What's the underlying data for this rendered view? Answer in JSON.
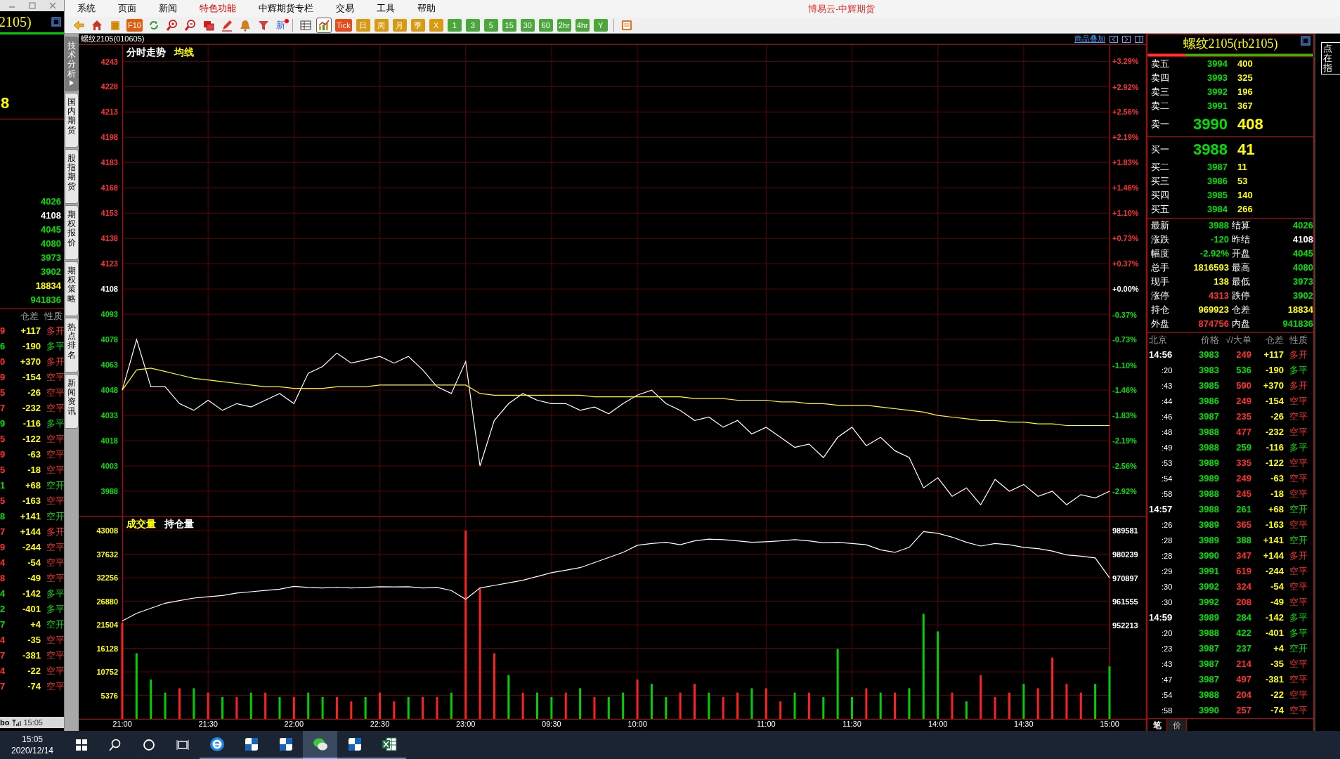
{
  "left_window": {
    "title": "2105)",
    "big_value": "8",
    "stats": [
      {
        "value": "4026",
        "color": "#00e000"
      },
      {
        "value": "4108",
        "color": "#ffffff"
      },
      {
        "value": "4045",
        "color": "#00e000"
      },
      {
        "value": "4080",
        "color": "#00e000"
      },
      {
        "value": "3973",
        "color": "#00e000"
      },
      {
        "value": "3902",
        "color": "#00e000"
      },
      {
        "value": "18834",
        "color": "#ffff00"
      },
      {
        "value": "941836",
        "color": "#00e000"
      }
    ],
    "tick_headers": [
      "仓差",
      "性质"
    ],
    "ticks": [
      {
        "column_1": "9",
        "oi_change": "+117",
        "nature": "多开",
        "color": "#ff3030"
      },
      {
        "column_1": "6",
        "oi_change": "-190",
        "nature": "多平",
        "color": "#00e000"
      },
      {
        "column_1": "0",
        "oi_change": "+370",
        "nature": "多开",
        "color": "#ff3030"
      },
      {
        "column_1": "9",
        "oi_change": "-154",
        "nature": "空平",
        "color": "#ff3030"
      },
      {
        "column_1": "5",
        "oi_change": "-26",
        "nature": "空平",
        "color": "#ff3030"
      },
      {
        "column_1": "7",
        "oi_change": "-232",
        "nature": "空平",
        "color": "#ff3030"
      },
      {
        "column_1": "9",
        "oi_change": "-116",
        "nature": "多平",
        "color": "#00e000"
      },
      {
        "column_1": "5",
        "oi_change": "-122",
        "nature": "空平",
        "color": "#ff3030"
      },
      {
        "column_1": "9",
        "oi_change": "-63",
        "nature": "空平",
        "color": "#ff3030"
      },
      {
        "column_1": "5",
        "oi_change": "-18",
        "nature": "空平",
        "color": "#ff3030"
      },
      {
        "column_1": "1",
        "oi_change": "+68",
        "nature": "空开",
        "color": "#00e000"
      },
      {
        "column_1": "5",
        "oi_change": "-163",
        "nature": "空平",
        "color": "#ff3030"
      },
      {
        "column_1": "8",
        "oi_change": "+141",
        "nature": "空开",
        "color": "#00e000"
      },
      {
        "column_1": "7",
        "oi_change": "+144",
        "nature": "多开",
        "color": "#ff3030"
      },
      {
        "column_1": "9",
        "oi_change": "-244",
        "nature": "空平",
        "color": "#ff3030"
      },
      {
        "column_1": "4",
        "oi_change": "-54",
        "nature": "空平",
        "color": "#ff3030"
      },
      {
        "column_1": "8",
        "oi_change": "-49",
        "nature": "空平",
        "color": "#ff3030"
      },
      {
        "column_1": "4",
        "oi_change": "-142",
        "nature": "多平",
        "color": "#00e000"
      },
      {
        "column_1": "2",
        "oi_change": "-401",
        "nature": "多平",
        "color": "#00e000"
      },
      {
        "column_1": "7",
        "oi_change": "+4",
        "nature": "空开",
        "color": "#00e000"
      },
      {
        "column_1": "4",
        "oi_change": "-35",
        "nature": "空平",
        "color": "#ff3030"
      },
      {
        "column_1": "7",
        "oi_change": "-381",
        "nature": "空平",
        "color": "#ff3030"
      },
      {
        "column_1": "4",
        "oi_change": "-22",
        "nature": "空平",
        "color": "#ff3030"
      },
      {
        "column_1": "7",
        "oi_change": "-74",
        "nature": "空平",
        "color": "#ff3030"
      }
    ],
    "status_bar": {
      "text": "bo",
      "time": "15:05"
    }
  },
  "menu": [
    {
      "label": "系统",
      "highlighted": false
    },
    {
      "label": "页面",
      "highlighted": false
    },
    {
      "label": "新闻",
      "highlighted": false
    },
    {
      "label": "特色功能",
      "highlighted": true
    },
    {
      "label": "中辉期货专栏",
      "highlighted": false
    },
    {
      "label": "交易",
      "highlighted": false
    },
    {
      "label": "工具",
      "highlighted": false
    },
    {
      "label": "帮助",
      "highlighted": false
    }
  ],
  "app_title": "博易云-中辉期货",
  "toolbar": [
    {
      "kind": "icon",
      "selected": false
    },
    {
      "kind": "icon",
      "selected": false
    },
    {
      "kind": "icon",
      "selected": false
    },
    {
      "kind": "text",
      "label": "F10",
      "color": "#e06010",
      "selected": false
    },
    {
      "kind": "icon",
      "selected": false
    },
    {
      "kind": "icon",
      "selected": false
    },
    {
      "kind": "icon",
      "selected": false
    },
    {
      "kind": "icon",
      "selected": false
    },
    {
      "kind": "icon",
      "selected": false
    },
    {
      "kind": "icon",
      "selected": false
    },
    {
      "kind": "icon",
      "selected": false
    },
    {
      "kind": "new",
      "label": "新",
      "selected": false
    },
    {
      "kind": "separator"
    },
    {
      "kind": "icon",
      "selected": false
    },
    {
      "kind": "icon",
      "selected": true
    },
    {
      "kind": "text",
      "label": "Tick",
      "color": "#e84a1a",
      "selected": false
    },
    {
      "kind": "text",
      "label": "日",
      "color": "#d89a10",
      "selected": false
    },
    {
      "kind": "text",
      "label": "周",
      "color": "#d89a10",
      "selected": false
    },
    {
      "kind": "text",
      "label": "月",
      "color": "#d89a10",
      "selected": false
    },
    {
      "kind": "text",
      "label": "季",
      "color": "#d89a10",
      "selected": false
    },
    {
      "kind": "text",
      "label": "X",
      "color": "#d89a10",
      "selected": false
    },
    {
      "kind": "text",
      "label": "1",
      "color": "#4aa83a",
      "selected": false
    },
    {
      "kind": "text",
      "label": "3",
      "color": "#4aa83a",
      "selected": false
    },
    {
      "kind": "text",
      "label": "5",
      "color": "#4aa83a",
      "selected": false
    },
    {
      "kind": "text",
      "label": "15",
      "color": "#4aa83a",
      "selected": false
    },
    {
      "kind": "text",
      "label": "30",
      "color": "#4aa83a",
      "selected": false
    },
    {
      "kind": "text",
      "label": "60",
      "color": "#4aa83a",
      "selected": false
    },
    {
      "kind": "text",
      "label": "2hr",
      "color": "#4aa83a",
      "selected": false
    },
    {
      "kind": "text",
      "label": "4hr",
      "color": "#4aa83a",
      "selected": false
    },
    {
      "kind": "text",
      "label": "Y",
      "color": "#4aa83a",
      "selected": false
    },
    {
      "kind": "separator"
    },
    {
      "kind": "icon",
      "selected": false
    }
  ],
  "side_tabs": [
    {
      "label": "技术分析",
      "selected": true
    },
    {
      "label": "国内期货",
      "selected": false
    },
    {
      "label": "股指期货",
      "selected": false
    },
    {
      "label": "期权报价",
      "selected": false
    },
    {
      "label": "期权策略",
      "selected": false
    },
    {
      "label": "热点排名",
      "selected": false
    },
    {
      "label": "新闻资讯",
      "selected": false
    }
  ],
  "chart_header": {
    "title": "螺纹2105(010605)",
    "overlay_link": "商品叠加"
  },
  "price_panel": {
    "legend": [
      {
        "label": "分时走势",
        "color": "#ffffff"
      },
      {
        "label": "均线",
        "color": "#ffff00"
      }
    ],
    "chart_data": {
      "type": "line",
      "grid": true,
      "ylim": [
        3973.4,
        4252.8
      ],
      "y2lim": [
        -3.277,
        3.525
      ],
      "yticks": [
        4243,
        4228,
        4213,
        4198,
        4183,
        4168,
        4153,
        4138,
        4123,
        4108,
        4093,
        4078,
        4063,
        4048,
        4033,
        4018,
        4003,
        3988
      ],
      "y2ticks": [
        {
          "value": 3.29,
          "label": "+3.29%"
        },
        {
          "value": 2.92,
          "label": "+2.92%"
        },
        {
          "value": 2.56,
          "label": "+2.56%"
        },
        {
          "value": 2.19,
          "label": "+2.19%"
        },
        {
          "value": 1.83,
          "label": "+1.83%"
        },
        {
          "value": 1.46,
          "label": "+1.46%"
        },
        {
          "value": 1.1,
          "label": "+1.10%"
        },
        {
          "value": 0.73,
          "label": "+0.73%"
        },
        {
          "value": 0.37,
          "label": "+0.37%"
        },
        {
          "value": 0,
          "label": "+0.00%"
        },
        {
          "value": -0.37,
          "label": "-0.37%"
        },
        {
          "value": -0.73,
          "label": "-0.73%"
        },
        {
          "value": -1.1,
          "label": "-1.10%"
        },
        {
          "value": -1.46,
          "label": "-1.46%"
        },
        {
          "value": -1.83,
          "label": "-1.83%"
        },
        {
          "value": -2.19,
          "label": "-2.19%"
        },
        {
          "value": -2.56,
          "label": "-2.56%"
        },
        {
          "value": -2.92,
          "label": "-2.92%"
        }
      ],
      "categories": [
        null,
        null,
        null,
        null,
        null,
        null,
        null,
        null,
        null,
        null,
        null,
        null,
        null,
        null,
        null,
        null,
        null,
        null,
        null,
        null,
        null,
        null,
        null,
        null,
        null,
        null,
        null,
        null,
        null,
        null,
        null,
        null,
        null,
        null,
        null,
        null,
        null,
        null,
        null,
        null,
        null,
        null,
        null,
        null,
        null,
        null,
        null,
        null,
        null,
        null,
        null,
        null,
        null,
        null,
        null,
        null,
        null,
        null,
        null,
        null,
        null,
        null,
        null,
        null,
        null,
        null,
        null,
        null,
        null,
        null
      ],
      "series": [
        {
          "color": "#ffffff",
          "values": [
            4048,
            4078,
            4050,
            4050,
            4040,
            4036,
            4042,
            4036,
            4040,
            4038,
            4042,
            4046,
            4040,
            4058,
            4062,
            4070,
            4064,
            4066,
            4068,
            4064,
            4068,
            4060,
            4050,
            4046,
            4065,
            4003,
            4030,
            4040,
            4046,
            4042,
            4040,
            4040,
            4036,
            4038,
            4034,
            4040,
            4045,
            4048,
            4040,
            4036,
            4030,
            4032,
            4026,
            4030,
            4022,
            4026,
            4020,
            4014,
            4016,
            4008,
            4020,
            4026,
            4015,
            4020,
            4012,
            4008,
            3990,
            3996,
            3985,
            3990,
            3980,
            3995,
            3988,
            3992,
            3985,
            3988,
            3980,
            3986,
            3984,
            3988
          ]
        },
        {
          "color": "#ffff00",
          "values": [
            4048,
            4060,
            4061,
            4059,
            4057,
            4055,
            4054,
            4053,
            4052,
            4051,
            4050,
            4050,
            4049,
            4049,
            4049,
            4050,
            4050,
            4050,
            4051,
            4051,
            4051,
            4051,
            4051,
            4051,
            4051,
            4046,
            4045,
            4045,
            4045,
            4045,
            4045,
            4045,
            4045,
            4044,
            4044,
            4044,
            4044,
            4044,
            4044,
            4044,
            4043,
            4043,
            4043,
            4042,
            4042,
            4042,
            4041,
            4041,
            4040,
            4040,
            4039,
            4039,
            4039,
            4038,
            4037,
            4036,
            4035,
            4033,
            4032,
            4031,
            4030,
            4030,
            4029,
            4029,
            4028,
            4028,
            4027,
            4027,
            4027,
            4027
          ]
        }
      ]
    }
  },
  "volume_panel": {
    "legend": [
      {
        "label": "成交量",
        "color": "#ffff00"
      },
      {
        "label": "持仓量",
        "color": "#ffffff"
      }
    ],
    "chart_data": {
      "type": "bar",
      "grid": true,
      "ylim": [
        0,
        46218
      ],
      "y2lim": [
        915400,
        995117
      ],
      "yticks": [
        43008,
        37632,
        32256,
        26880,
        21504,
        16128,
        10752,
        5376
      ],
      "y2ticks": [
        989581,
        980239,
        970897,
        961555,
        952213
      ],
      "categories": [
        "21:00",
        null,
        null,
        null,
        null,
        null,
        "21:30",
        null,
        null,
        null,
        null,
        null,
        "22:00",
        null,
        null,
        null,
        null,
        null,
        "22:30",
        null,
        null,
        null,
        null,
        null,
        "23:00",
        null,
        null,
        null,
        null,
        null,
        "09:30",
        null,
        null,
        null,
        null,
        null,
        "10:00",
        null,
        null,
        null,
        null,
        null,
        null,
        null,
        null,
        "11:00",
        null,
        null,
        null,
        null,
        null,
        "11:30",
        null,
        null,
        null,
        null,
        null,
        "14:00",
        null,
        null,
        null,
        null,
        null,
        "14:30",
        null,
        null,
        null,
        null,
        null,
        "15:00"
      ],
      "series": [
        {
          "type": "bar",
          "color": "#ff2020",
          "values": [
            22000,
            null,
            null,
            null,
            7000,
            null,
            6000,
            null,
            5000,
            null,
            6000,
            null,
            5000,
            null,
            null,
            5000,
            4000,
            null,
            6000,
            4000,
            null,
            5000,
            5000,
            null,
            43000,
            30000,
            15000,
            null,
            6000,
            null,
            null,
            6000,
            null,
            5000,
            null,
            null,
            9000,
            null,
            null,
            6000,
            8000,
            null,
            5000,
            6000,
            null,
            7000,
            4000,
            null,
            6000,
            null,
            null,
            null,
            7000,
            null,
            6000,
            null,
            null,
            null,
            6000,
            null,
            10000,
            5000,
            6000,
            null,
            7000,
            14000,
            8000,
            6000,
            null,
            null
          ]
        },
        {
          "type": "bar",
          "color": "#00d000",
          "values": [
            null,
            15000,
            9000,
            6000,
            null,
            7000,
            null,
            5000,
            null,
            6000,
            null,
            5000,
            null,
            6000,
            5000,
            null,
            null,
            5000,
            null,
            null,
            5000,
            null,
            null,
            6000,
            null,
            null,
            null,
            10000,
            null,
            6000,
            5000,
            null,
            7000,
            null,
            5000,
            6000,
            null,
            8000,
            5000,
            null,
            null,
            6000,
            null,
            null,
            7000,
            null,
            null,
            6000,
            null,
            5000,
            16000,
            5000,
            null,
            6000,
            null,
            7000,
            24000,
            20000,
            null,
            4000,
            null,
            null,
            null,
            8000,
            null,
            null,
            null,
            null,
            8000,
            12000
          ]
        },
        {
          "type": "line",
          "color": "#ffffff",
          "axis": "y2",
          "values": [
            954000,
            957000,
            959000,
            961000,
            962000,
            963000,
            963500,
            964000,
            965000,
            965500,
            966000,
            966500,
            967600,
            967200,
            967000,
            967300,
            967000,
            967200,
            967500,
            967400,
            967500,
            967000,
            967200,
            966000,
            962500,
            967000,
            968000,
            969000,
            970000,
            971500,
            973000,
            974000,
            975000,
            977000,
            979000,
            981000,
            983800,
            984500,
            985000,
            984000,
            985500,
            986200,
            986000,
            985500,
            985000,
            985200,
            985500,
            986000,
            985500,
            984800,
            985000,
            984500,
            984000,
            982000,
            981000,
            983000,
            989200,
            988500,
            987000,
            985000,
            983500,
            984500,
            984000,
            983000,
            982500,
            981500,
            980000,
            979500,
            978800,
            971000
          ]
        }
      ]
    }
  },
  "quote_panel": {
    "title": "螺纹2105(rb2105)",
    "ratio_bar": {
      "level": 0.23
    },
    "asks": [
      {
        "label": "卖五",
        "price": "3994",
        "volume": "400",
        "best": false
      },
      {
        "label": "卖四",
        "price": "3993",
        "volume": "325",
        "best": false
      },
      {
        "label": "卖三",
        "price": "3992",
        "volume": "196",
        "best": false
      },
      {
        "label": "卖二",
        "price": "3991",
        "volume": "367",
        "best": false
      },
      {
        "label": "卖一",
        "price": "3990",
        "volume": "408",
        "best": true
      }
    ],
    "bids": [
      {
        "label": "买一",
        "price": "3988",
        "volume": "41",
        "best": true
      },
      {
        "label": "买二",
        "price": "3987",
        "volume": "11",
        "best": false
      },
      {
        "label": "买三",
        "price": "3986",
        "volume": "53",
        "best": false
      },
      {
        "label": "买四",
        "price": "3985",
        "volume": "140",
        "best": false
      },
      {
        "label": "买五",
        "price": "3984",
        "volume": "266",
        "best": false
      }
    ],
    "stats": [
      {
        "label": "最新",
        "value": "3988",
        "color": "#00e000"
      },
      {
        "label": "结算",
        "value": "4026",
        "color": "#00e000"
      },
      {
        "label": "涨跌",
        "value": "-120",
        "color": "#00e000"
      },
      {
        "label": "昨结",
        "value": "4108",
        "color": "#ffffff"
      },
      {
        "label": "幅度",
        "value": "-2.92%",
        "color": "#00e000"
      },
      {
        "label": "开盘",
        "value": "4045",
        "color": "#00e000"
      },
      {
        "label": "总手",
        "value": "1816593",
        "color": "#ffff00"
      },
      {
        "label": "最高",
        "value": "4080",
        "color": "#00e000"
      },
      {
        "label": "现手",
        "value": "138",
        "color": "#ffff00"
      },
      {
        "label": "最低",
        "value": "3973",
        "color": "#00e000"
      },
      {
        "label": "涨停",
        "value": "4313",
        "color": "#ff3030"
      },
      {
        "label": "跌停",
        "value": "3902",
        "color": "#00e000"
      },
      {
        "label": "持仓",
        "value": "969923",
        "color": "#ffff00"
      },
      {
        "label": "仓差",
        "value": "18834",
        "color": "#ffff00"
      },
      {
        "label": "外盘",
        "value": "874756",
        "color": "#ff3030"
      },
      {
        "label": "内盘",
        "value": "941836",
        "color": "#00e000"
      }
    ],
    "tick_headers": [
      "北京",
      "价格",
      "√/大单",
      "仓差",
      "性质"
    ],
    "ticks": [
      {
        "time": "14:56",
        "kind": "minute",
        "price": "3983",
        "volume": "249",
        "oi_change": "+117",
        "nature": "多开",
        "color": "#ff3030"
      },
      {
        "time": ":20",
        "kind": "second",
        "price": "3983",
        "volume": "536",
        "oi_change": "-190",
        "nature": "多平",
        "color": "#00e000"
      },
      {
        "time": ":43",
        "kind": "second",
        "price": "3985",
        "volume": "590",
        "oi_change": "+370",
        "nature": "多开",
        "color": "#ff3030"
      },
      {
        "time": ":44",
        "kind": "second",
        "price": "3986",
        "volume": "249",
        "oi_change": "-154",
        "nature": "空平",
        "color": "#ff3030"
      },
      {
        "time": ":46",
        "kind": "second",
        "price": "3987",
        "volume": "235",
        "oi_change": "-26",
        "nature": "空平",
        "color": "#ff3030"
      },
      {
        "time": ":48",
        "kind": "second",
        "price": "3988",
        "volume": "477",
        "oi_change": "-232",
        "nature": "空平",
        "color": "#ff3030"
      },
      {
        "time": ":49",
        "kind": "second",
        "price": "3988",
        "volume": "259",
        "oi_change": "-116",
        "nature": "多平",
        "color": "#00e000"
      },
      {
        "time": ":53",
        "kind": "second",
        "price": "3989",
        "volume": "335",
        "oi_change": "-122",
        "nature": "空平",
        "color": "#ff3030"
      },
      {
        "time": ":54",
        "kind": "second",
        "price": "3989",
        "volume": "249",
        "oi_change": "-63",
        "nature": "空平",
        "color": "#ff3030"
      },
      {
        "time": ":58",
        "kind": "second",
        "price": "3988",
        "volume": "245",
        "oi_change": "-18",
        "nature": "空平",
        "color": "#ff3030"
      },
      {
        "time": "14:57",
        "kind": "minute",
        "price": "3988",
        "volume": "261",
        "oi_change": "+68",
        "nature": "空开",
        "color": "#00e000"
      },
      {
        "time": ":26",
        "kind": "second",
        "price": "3989",
        "volume": "365",
        "oi_change": "-163",
        "nature": "空平",
        "color": "#ff3030"
      },
      {
        "time": ":28",
        "kind": "second",
        "price": "3989",
        "volume": "388",
        "oi_change": "+141",
        "nature": "空开",
        "color": "#00e000"
      },
      {
        "time": ":28",
        "kind": "second",
        "price": "3990",
        "volume": "347",
        "oi_change": "+144",
        "nature": "多开",
        "color": "#ff3030"
      },
      {
        "time": ":29",
        "kind": "second",
        "price": "3991",
        "volume": "619",
        "oi_change": "-244",
        "nature": "空平",
        "color": "#ff3030"
      },
      {
        "time": ":30",
        "kind": "second",
        "price": "3992",
        "volume": "324",
        "oi_change": "-54",
        "nature": "空平",
        "color": "#ff3030"
      },
      {
        "time": ":30",
        "kind": "second",
        "price": "3992",
        "volume": "208",
        "oi_change": "-49",
        "nature": "空平",
        "color": "#ff3030"
      },
      {
        "time": "14:59",
        "kind": "minute",
        "price": "3989",
        "volume": "284",
        "oi_change": "-142",
        "nature": "多平",
        "color": "#00e000"
      },
      {
        "time": ":20",
        "kind": "second",
        "price": "3988",
        "volume": "422",
        "oi_change": "-401",
        "nature": "多平",
        "color": "#00e000"
      },
      {
        "time": ":23",
        "kind": "second",
        "price": "3987",
        "volume": "237",
        "oi_change": "+4",
        "nature": "空开",
        "color": "#00e000"
      },
      {
        "time": ":43",
        "kind": "second",
        "price": "3987",
        "volume": "214",
        "oi_change": "-35",
        "nature": "空平",
        "color": "#ff3030"
      },
      {
        "time": ":47",
        "kind": "second",
        "price": "3987",
        "volume": "497",
        "oi_change": "-381",
        "nature": "空平",
        "color": "#ff3030"
      },
      {
        "time": ":54",
        "kind": "second",
        "price": "3988",
        "volume": "204",
        "oi_change": "-22",
        "nature": "空平",
        "color": "#ff3030"
      },
      {
        "time": ":58",
        "kind": "second",
        "price": "3990",
        "volume": "257",
        "oi_change": "-74",
        "nature": "空平",
        "color": "#ff3030"
      }
    ],
    "bottom_tabs": [
      {
        "label": "笔",
        "selected": true
      },
      {
        "label": "价",
        "selected": false
      }
    ]
  },
  "side_note": {
    "lines": [
      "点",
      "在",
      "指"
    ]
  },
  "taskbar": {
    "time": "15:05",
    "date": "2020/12/14",
    "apps": [
      {
        "active": false
      },
      {
        "active": false
      },
      {
        "active": false
      },
      {
        "active": true
      },
      {
        "active": false
      },
      {
        "active": false
      }
    ]
  }
}
